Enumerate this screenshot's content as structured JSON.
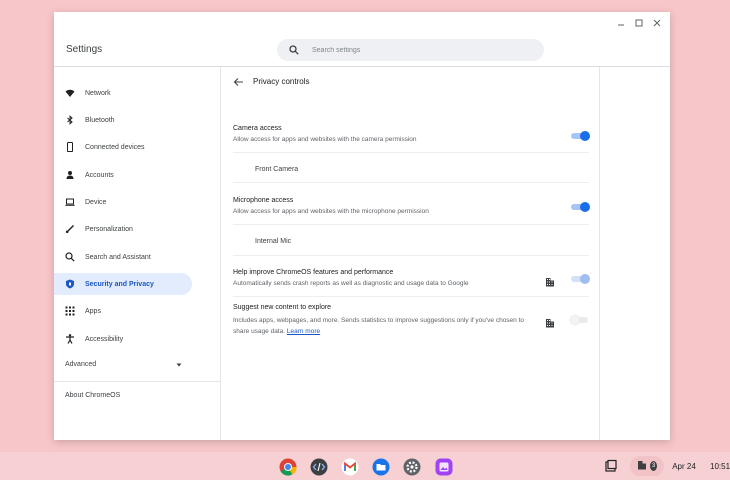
{
  "window": {
    "title": "Settings"
  },
  "search": {
    "placeholder": "Search settings"
  },
  "sidebar": {
    "items": [
      {
        "label": "Network",
        "icon": "wifi-icon"
      },
      {
        "label": "Bluetooth",
        "icon": "bluetooth-icon"
      },
      {
        "label": "Connected devices",
        "icon": "phone-icon"
      },
      {
        "label": "Accounts",
        "icon": "person-icon"
      },
      {
        "label": "Device",
        "icon": "laptop-icon"
      },
      {
        "label": "Personalization",
        "icon": "brush-icon"
      },
      {
        "label": "Search and Assistant",
        "icon": "search-icon"
      },
      {
        "label": "Security and Privacy",
        "icon": "shield-icon",
        "active": true
      },
      {
        "label": "Apps",
        "icon": "apps-grid-icon"
      },
      {
        "label": "Accessibility",
        "icon": "accessibility-icon"
      }
    ],
    "advanced": "Advanced",
    "about": "About ChromeOS"
  },
  "main": {
    "title": "Privacy controls",
    "camera": {
      "title": "Camera access",
      "subtitle": "Allow access for apps and websites with the camera permission",
      "device": "Front Camera",
      "enabled": true
    },
    "microphone": {
      "title": "Microphone access",
      "subtitle": "Allow access for apps and websites with the microphone permission",
      "device": "Internal Mic",
      "enabled": true
    },
    "help_improve": {
      "title": "Help improve ChromeOS features and performance",
      "subtitle": "Automatically sends crash reports as well as diagnostic and usage data to Google",
      "enabled": true,
      "managed": true
    },
    "suggest": {
      "title": "Suggest new content to explore",
      "subtitle": "Includes apps, webpages, and more. Sends statistics to improve suggestions only if you've chosen to share usage data.",
      "link": "Learn more",
      "enabled": false,
      "managed": true
    }
  },
  "shelf": {
    "apps": [
      "chrome-icon",
      "terminal-icon",
      "gmail-icon",
      "files-icon",
      "settings-icon",
      "gallery-icon"
    ],
    "notification_count": "3",
    "date": "Apr 24",
    "time": "10:51"
  },
  "colors": {
    "accent": "#1a6ee8",
    "wallpaper": "#f7c6c8",
    "active_nav": "#e3ecfc"
  }
}
